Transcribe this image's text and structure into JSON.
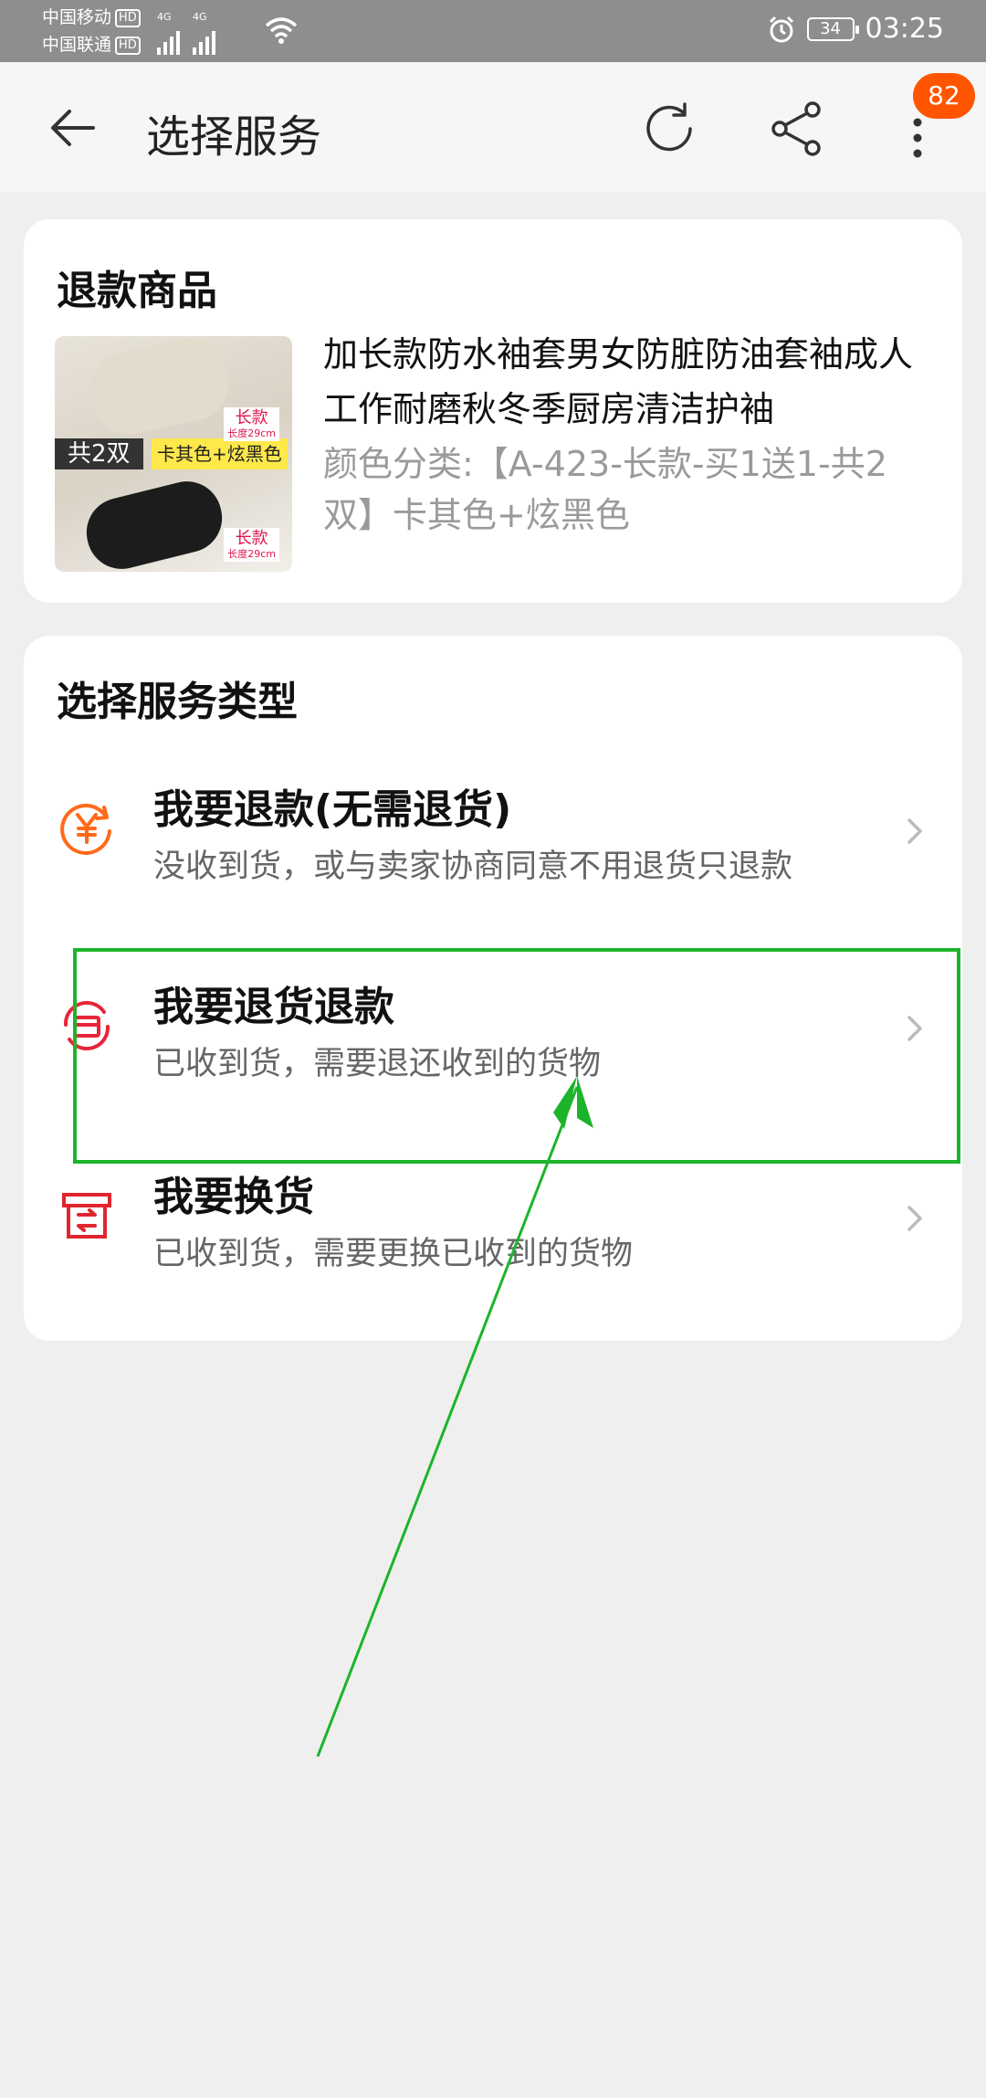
{
  "status_bar": {
    "carrier1": "中国移动",
    "carrier2": "中国联通",
    "hd": "HD",
    "network": "4G",
    "battery": "34",
    "time": "03:25"
  },
  "header": {
    "title": "选择服务",
    "badge_count": "82"
  },
  "product_card": {
    "title": "退款商品",
    "name": "加长款防水袖套男女防脏防油套袖成人工作耐磨秋冬季厨房清洁护袖",
    "sku": "颜色分类:【A-423-长款-买1送1-共2双】卡其色+炫黑色",
    "image": {
      "pair_label": "共2双",
      "color_label": "卡其色+炫黑色",
      "tag1": "长款",
      "tag1_sub": "长度29cm",
      "tag2": "长款",
      "tag2_sub": "长度29cm"
    }
  },
  "service_card": {
    "title": "选择服务类型",
    "options": [
      {
        "title": "我要退款(无需退货)",
        "desc": "没收到货，或与卖家协商同意不用退货只退款",
        "icon": "yuan-refund-icon"
      },
      {
        "title": "我要退货退款",
        "desc": "已收到货，需要退还收到的货物",
        "icon": "return-refund-icon"
      },
      {
        "title": "我要换货",
        "desc": "已收到货，需要更换已收到的货物",
        "icon": "exchange-box-icon"
      }
    ]
  },
  "colors": {
    "accent_orange": "#ff5500",
    "annotation_green": "#1db42b",
    "refund_icon": "#ff6a1a",
    "return_icon": "#e8253a",
    "exchange_icon": "#e0252e"
  }
}
